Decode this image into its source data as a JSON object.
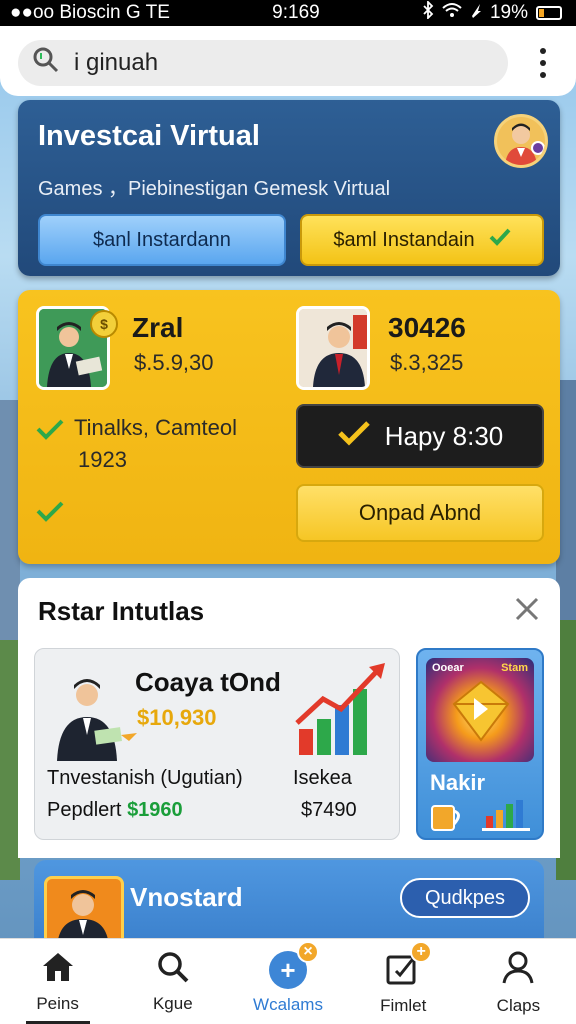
{
  "status_bar": {
    "carrier": "●●oo Bioscin G  TE",
    "time": "9:169",
    "battery": "19%"
  },
  "search": {
    "value": "i ginuah"
  },
  "hero": {
    "title": "Investcai Virtual",
    "subtitle": "Games ，Piebinestigan Gemesk Virtual",
    "button_left": "$anl Instardann",
    "button_right": "$aml Instandain"
  },
  "investors": {
    "left": {
      "name": "Zral",
      "amount": "$.5.9,30",
      "coin": "$"
    },
    "right": {
      "name": "30426",
      "amount": "$.3,325"
    },
    "detail_line1": "Tinalks, Camteol",
    "detail_line2": "1923",
    "happy_label": "Hapy 8:30",
    "action_label": "Onpad Abnd"
  },
  "panel": {
    "title": "Rstar Intutlas",
    "investment": {
      "name": "Coaya tOnd",
      "amount": "$10,930",
      "line1_left": "Tnvestanish (Ugutian)",
      "line2_left_label": "Pepdlert",
      "line2_left_value": "$1960",
      "line1_right": "Isekea",
      "line2_right": "$7490"
    },
    "game": {
      "tag_left": "Ooear",
      "tag_right": "Stam",
      "name": "Nakir"
    }
  },
  "promo": {
    "title": "Vnostard",
    "button": "Qudkpes"
  },
  "tabs": [
    {
      "label": "Peins",
      "icon": "home-icon"
    },
    {
      "label": "Kgue",
      "icon": "search-icon"
    },
    {
      "label": "Wcalams",
      "icon": "plus-icon",
      "badge": "×"
    },
    {
      "label": "Fimlet",
      "icon": "edit-icon",
      "badge": "+"
    },
    {
      "label": "Claps",
      "icon": "profile-icon"
    }
  ],
  "colors": {
    "hero_blue": "#2e5f95",
    "accent_yellow": "#f8c31f",
    "active_tab": "#2f7bd3",
    "positive_green": "#1a9e3a"
  }
}
